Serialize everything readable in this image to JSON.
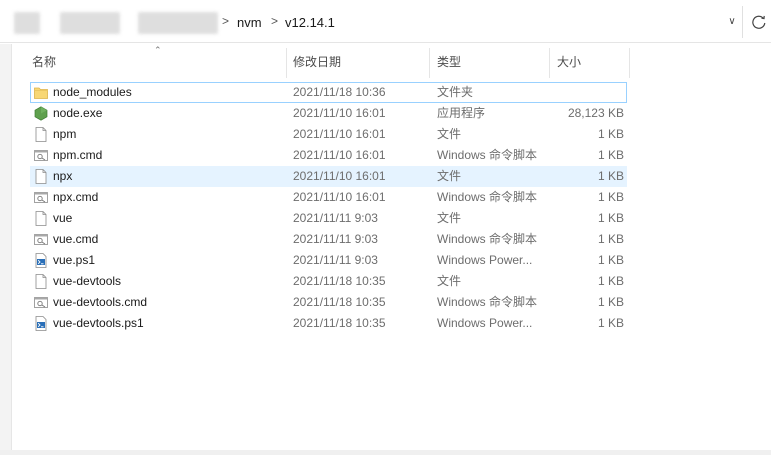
{
  "address": {
    "path": [
      "nvm",
      "v12.14.1"
    ],
    "separator": ">"
  },
  "columns": {
    "name": "名称",
    "date": "修改日期",
    "type": "类型",
    "size": "大小"
  },
  "files": [
    {
      "name": "node_modules",
      "date": "2021/11/18 10:36",
      "type": "文件夹",
      "size": "",
      "icon": "folder-icon"
    },
    {
      "name": "node.exe",
      "date": "2021/11/10 16:01",
      "type": "应用程序",
      "size": "28,123 KB",
      "icon": "nodejs-app-icon"
    },
    {
      "name": "npm",
      "date": "2021/11/10 16:01",
      "type": "文件",
      "size": "1 KB",
      "icon": "file-icon"
    },
    {
      "name": "npm.cmd",
      "date": "2021/11/10 16:01",
      "type": "Windows 命令脚本",
      "size": "1 KB",
      "icon": "cmd-script-icon"
    },
    {
      "name": "npx",
      "date": "2021/11/10 16:01",
      "type": "文件",
      "size": "1 KB",
      "icon": "file-icon"
    },
    {
      "name": "npx.cmd",
      "date": "2021/11/10 16:01",
      "type": "Windows 命令脚本",
      "size": "1 KB",
      "icon": "cmd-script-icon"
    },
    {
      "name": "vue",
      "date": "2021/11/11 9:03",
      "type": "文件",
      "size": "1 KB",
      "icon": "file-icon"
    },
    {
      "name": "vue.cmd",
      "date": "2021/11/11 9:03",
      "type": "Windows 命令脚本",
      "size": "1 KB",
      "icon": "cmd-script-icon"
    },
    {
      "name": "vue.ps1",
      "date": "2021/11/11 9:03",
      "type": "Windows Power...",
      "size": "1 KB",
      "icon": "powershell-script-icon"
    },
    {
      "name": "vue-devtools",
      "date": "2021/11/18 10:35",
      "type": "文件",
      "size": "1 KB",
      "icon": "file-icon"
    },
    {
      "name": "vue-devtools.cmd",
      "date": "2021/11/18 10:35",
      "type": "Windows 命令脚本",
      "size": "1 KB",
      "icon": "cmd-script-icon"
    },
    {
      "name": "vue-devtools.ps1",
      "date": "2021/11/18 10:35",
      "type": "Windows Power...",
      "size": "1 KB",
      "icon": "powershell-script-icon"
    }
  ],
  "colors": {
    "selection_border": "#99d1ff",
    "hover_bg": "#e5f3ff",
    "folder": "#f8d775",
    "nodejs": "#5fa04e"
  }
}
